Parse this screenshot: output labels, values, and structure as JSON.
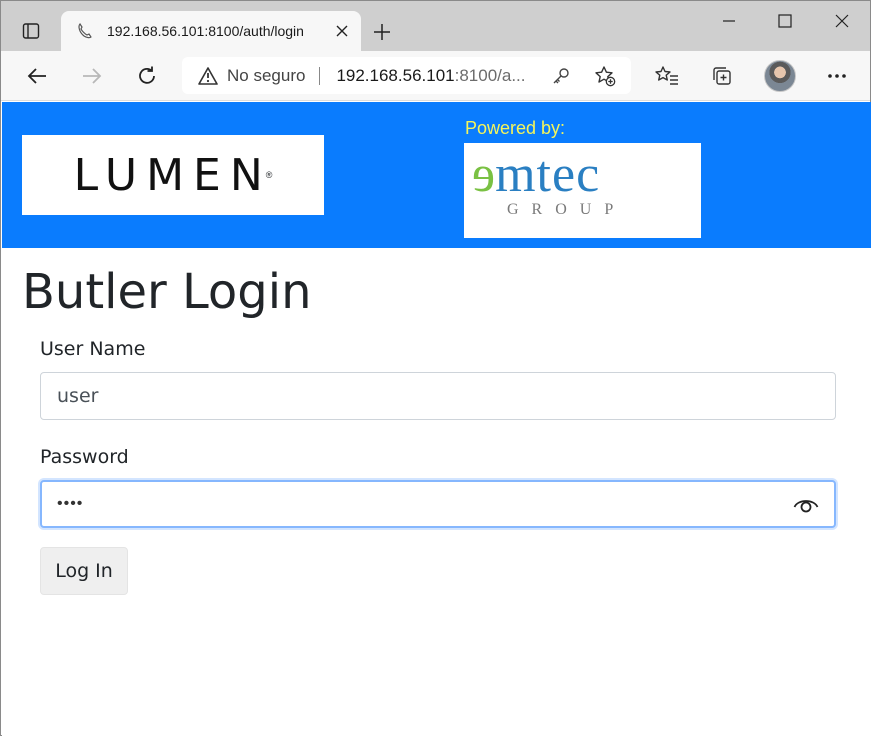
{
  "browser": {
    "tab": {
      "title": "192.168.56.101:8100/auth/login",
      "favicon": "phone-handset-icon"
    },
    "address_bar": {
      "security_label": "No seguro",
      "url_host": "192.168.56.101",
      "url_rest": ":8100/a..."
    },
    "icons": {
      "tab_actions": "tab-actions-icon",
      "close_tab": "close-icon",
      "new_tab": "plus-icon",
      "minimize": "minimize-icon",
      "maximize": "maximize-icon",
      "close_window": "close-icon",
      "back": "back-arrow-icon",
      "forward": "forward-arrow-icon",
      "refresh": "refresh-icon",
      "warning": "warning-icon",
      "key": "key-icon",
      "add_favorite": "star-add-icon",
      "favorites": "favorites-list-icon",
      "collections": "collections-icon",
      "profile": "avatar",
      "more": "more-icon"
    }
  },
  "page": {
    "header": {
      "logo_text": "LUMEN",
      "powered_by": "Powered by:",
      "partner_logo": {
        "word": "mtec",
        "e": "e",
        "sub": "GROUP"
      },
      "band_color": "#0a7cfe"
    },
    "title": "Butler Login",
    "form": {
      "username_label": "User Name",
      "username_value": "user",
      "password_label": "Password",
      "password_masked": "••••",
      "submit_label": "Log In"
    }
  }
}
